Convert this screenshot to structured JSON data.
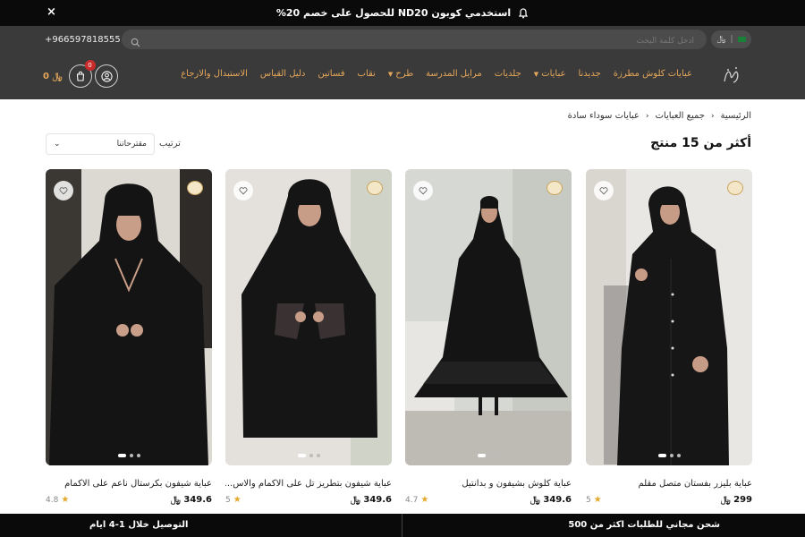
{
  "announcement": {
    "text": "استخدمي كوبون ND20 للحصول على خصم 20%",
    "close_label": "×"
  },
  "header": {
    "phone": "+966597818555",
    "search_placeholder": "ادخل كلمة البحث",
    "currency": "﷼",
    "cart_total": "0 ﷼",
    "cart_count": "0",
    "nav": [
      {
        "label": "عبايات كلوش مطرزة",
        "dropdown": false
      },
      {
        "label": "جديدنا",
        "dropdown": false
      },
      {
        "label": "عبايات",
        "dropdown": true
      },
      {
        "label": "جلديات",
        "dropdown": false
      },
      {
        "label": "مرايل المدرسة",
        "dropdown": false
      },
      {
        "label": "طرح",
        "dropdown": true
      },
      {
        "label": "نقاب",
        "dropdown": false
      },
      {
        "label": "فساتين",
        "dropdown": false
      },
      {
        "label": "دليل القياس",
        "dropdown": false
      },
      {
        "label": "الاستبدال والارجاع",
        "dropdown": false
      }
    ]
  },
  "breadcrumb": [
    "الرئيسية",
    "جميع العبايات",
    "عبايات سوداء سادة"
  ],
  "listing": {
    "count_title": "أكثر من 15 منتج",
    "sort_label": "ترتيب",
    "sort_value": "مقترحاتنا"
  },
  "products": [
    {
      "name": "عباية بليزر بفستان متصل مقلم",
      "price": "299 ﷼",
      "rating": "5"
    },
    {
      "name": "عباية كلوش بشيفون و بدانتيل",
      "price": "349.6 ﷼",
      "rating": "4.7"
    },
    {
      "name": "عباية شيفون بتطريز تل على الاكمام والاس...",
      "price": "349.6 ﷼",
      "rating": "5"
    },
    {
      "name": "عباية شيفون بكرستال ناعم على الاكمام",
      "price": "349.6 ﷼",
      "rating": "4.8"
    }
  ],
  "footer_bar": {
    "right": "شحن مجاني للطلبات اكثر من 500",
    "left": "التوصيل خلال 1-4 ايام"
  },
  "colors": {
    "accent": "#e6a75a",
    "header_bg": "#3a3a3a",
    "bar_bg": "#0a0a0a"
  }
}
